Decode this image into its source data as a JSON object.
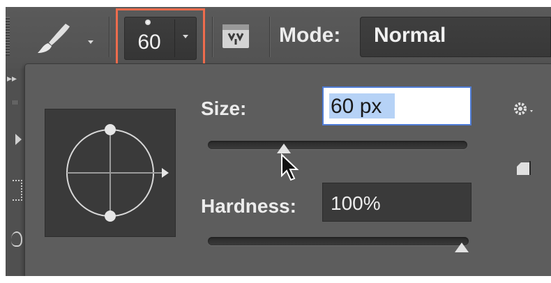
{
  "options_bar": {
    "brush_size_value": "60",
    "mode_label": "Mode:",
    "mode_value": "Normal"
  },
  "brush_picker": {
    "size_label": "Size:",
    "size_value": "60 px",
    "size_slider_fraction": 0.28,
    "hardness_label": "Hardness:",
    "hardness_value": "100%",
    "hardness_slider_fraction": 1.0
  },
  "icons": {
    "brush_tool": "brush-icon",
    "brush_panel_toggle": "brush-panel-toggle-icon",
    "settings": "gear-icon",
    "new_preset": "new-preset-icon",
    "cursor": "mouse-pointer-icon",
    "tip_preview": "brush-tip-preview-icon"
  },
  "colors": {
    "highlight_outline": "#ee6c4d",
    "selection": "#b6d2f6",
    "input_focus": "#4f7cd6"
  }
}
